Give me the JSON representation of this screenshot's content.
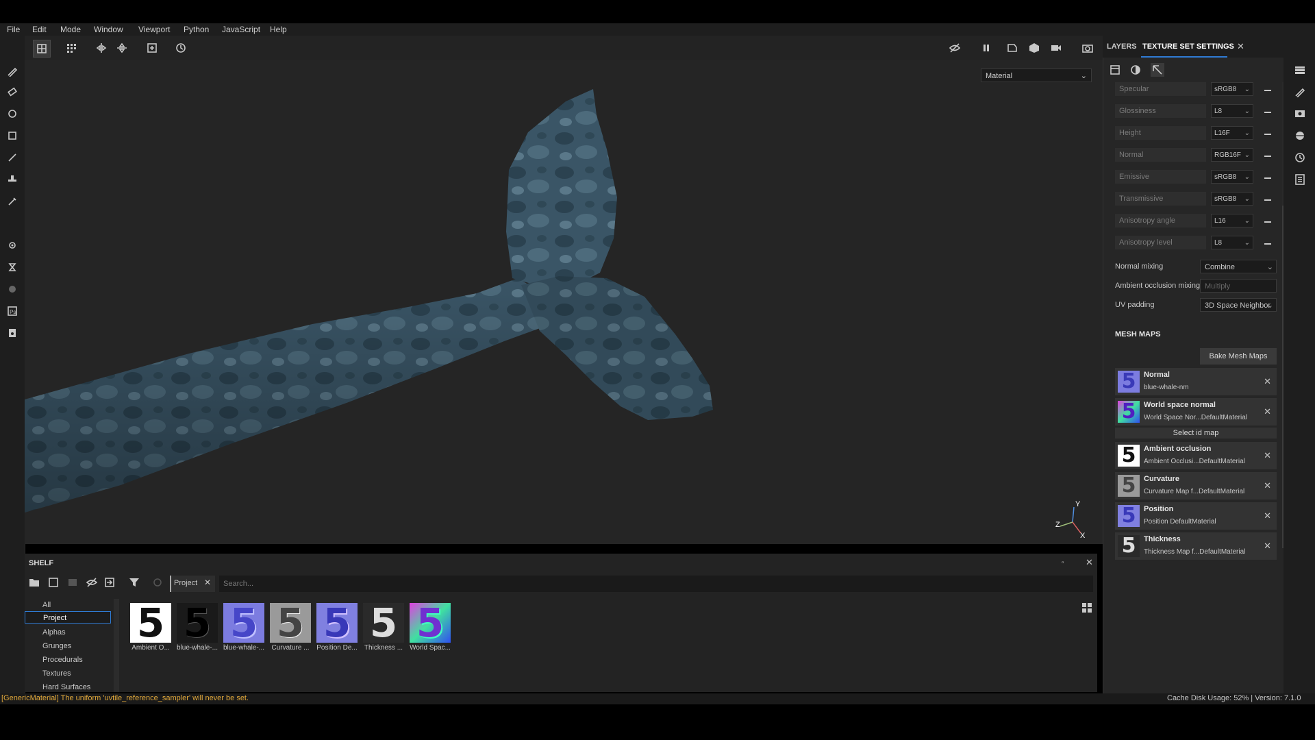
{
  "menu": [
    "File",
    "Edit",
    "Mode",
    "Window",
    "Viewport",
    "Python",
    "JavaScript",
    "Help"
  ],
  "viewport": {
    "material_select": "Material"
  },
  "axis": {
    "x": "X",
    "y": "Y",
    "z": "Z"
  },
  "shelf": {
    "title": "SHELF",
    "filter_chip": "Project",
    "search_placeholder": "Search...",
    "categories": [
      "All",
      "Project",
      "Alphas",
      "Grunges",
      "Procedurals",
      "Textures",
      "Hard Surfaces"
    ],
    "selected_category": "Project",
    "items": [
      "Ambient O...",
      "blue-whale-...",
      "blue-whale-...",
      "Curvature ...",
      "Position De...",
      "Thickness ...",
      "World Spac..."
    ]
  },
  "right_panel": {
    "tabs": [
      "LAYERS",
      "TEXTURE SET SETTINGS"
    ],
    "active_tab": "TEXTURE SET SETTINGS",
    "channels": [
      {
        "name": "Specular",
        "format": "sRGB8"
      },
      {
        "name": "Glossiness",
        "format": "L8"
      },
      {
        "name": "Height",
        "format": "L16F"
      },
      {
        "name": "Normal",
        "format": "RGB16F"
      },
      {
        "name": "Emissive",
        "format": "sRGB8"
      },
      {
        "name": "Transmissive",
        "format": "sRGB8"
      },
      {
        "name": "Anisotropy angle",
        "format": "L16"
      },
      {
        "name": "Anisotropy level",
        "format": "L8"
      }
    ],
    "normal_mixing": {
      "label": "Normal mixing",
      "value": "Combine"
    },
    "ao_mixing": {
      "label": "Ambient occlusion mixing",
      "value": "Multiply"
    },
    "uv_padding": {
      "label": "UV padding",
      "value": "3D Space Neighbor"
    },
    "mesh_maps_title": "MESH MAPS",
    "bake_button": "Bake Mesh Maps",
    "select_id_map": "Select id map",
    "mesh_maps": [
      {
        "title": "Normal",
        "sub": "blue-whale-nm"
      },
      {
        "title": "World space normal",
        "sub": "World Space Nor...DefaultMaterial"
      },
      {
        "title": "Ambient occlusion",
        "sub": "Ambient Occlusi...DefaultMaterial"
      },
      {
        "title": "Curvature",
        "sub": "Curvature Map f...DefaultMaterial"
      },
      {
        "title": "Position",
        "sub": "Position DefaultMaterial"
      },
      {
        "title": "Thickness",
        "sub": "Thickness Map f...DefaultMaterial"
      }
    ]
  },
  "status": {
    "message": "[GenericMaterial] The uniform 'uvtile_reference_sampler' will never be set.",
    "right": "Cache Disk Usage:     52% | Version: 7.1.0"
  },
  "thumb_glyph": "5",
  "colors": {
    "accent": "#2f7bd4",
    "warning": "#e2a93b",
    "whale": "#3f5a6b"
  }
}
